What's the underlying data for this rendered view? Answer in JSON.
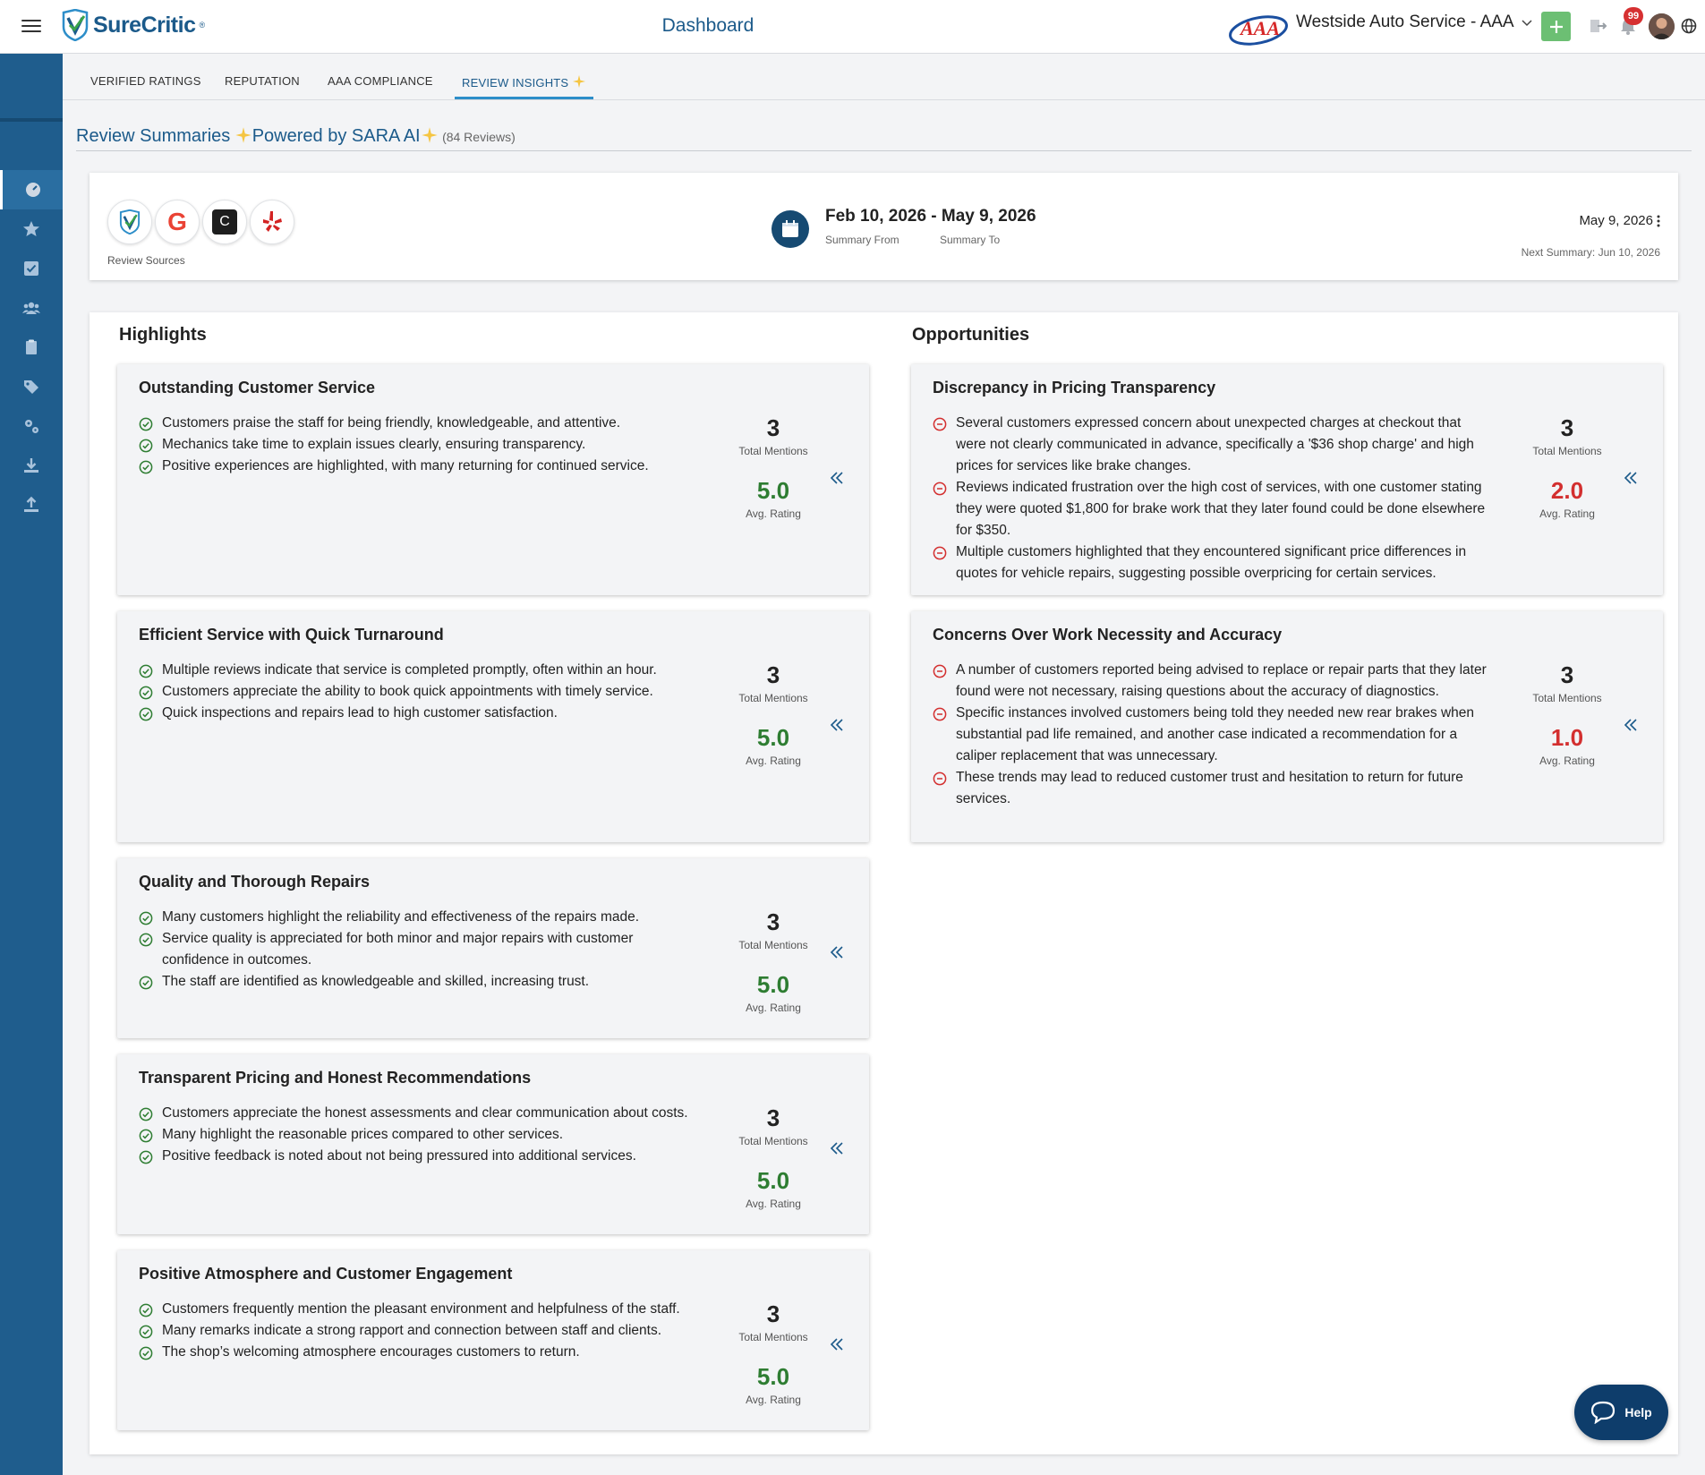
{
  "topbar": {
    "brand": "SureCritic",
    "brand_tm": "®",
    "title": "Dashboard",
    "aaa_logo_text": "AAA",
    "location": "Westside Auto Service - AAA",
    "notification_count": "99"
  },
  "tabs": [
    {
      "label": "VERIFIED RATINGS"
    },
    {
      "label": "REPUTATION"
    },
    {
      "label": "AAA COMPLIANCE"
    },
    {
      "label": "REVIEW INSIGHTS"
    }
  ],
  "section": {
    "title": "Review Summaries",
    "powered": "Powered by SARA AI",
    "count": "(84 Reviews)"
  },
  "sources": {
    "label": "Review Sources",
    "items": [
      "surecritic-source",
      "google-source",
      "carfax-source",
      "yelp-source"
    ],
    "carfax_letter": "C",
    "google_letter": "G"
  },
  "dates": {
    "range": "Feb 10, 2026 - May 9, 2026",
    "from_label": "Summary From",
    "to_label": "Summary To",
    "current": "May 9, 2026",
    "next": "Next Summary: Jun 10, 2026"
  },
  "highlights": {
    "heading": "Highlights",
    "cards": [
      {
        "title": "Outstanding Customer Service",
        "bullets": [
          "Customers praise the staff for being friendly, knowledgeable, and attentive.",
          "Mechanics take time to explain issues clearly, ensuring transparency.",
          "Positive experiences are highlighted, with many returning for continued service."
        ],
        "mentions": "3",
        "mentions_label": "Total Mentions",
        "rating": "5.0",
        "rating_label": "Avg. Rating"
      },
      {
        "title": "Efficient Service with Quick Turnaround",
        "bullets": [
          "Multiple reviews indicate that service is completed promptly, often within an hour.",
          "Customers appreciate the ability to book quick appointments with timely service.",
          "Quick inspections and repairs lead to high customer satisfaction."
        ],
        "mentions": "3",
        "mentions_label": "Total Mentions",
        "rating": "5.0",
        "rating_label": "Avg. Rating"
      },
      {
        "title": "Quality and Thorough Repairs",
        "bullets": [
          "Many customers highlight the reliability and effectiveness of the repairs made.",
          "Service quality is appreciated for both minor and major repairs with customer confidence in outcomes.",
          "The staff are identified as knowledgeable and skilled, increasing trust."
        ],
        "mentions": "3",
        "mentions_label": "Total Mentions",
        "rating": "5.0",
        "rating_label": "Avg. Rating"
      },
      {
        "title": "Transparent Pricing and Honest Recommendations",
        "bullets": [
          "Customers appreciate the honest assessments and clear communication about costs.",
          "Many highlight the reasonable prices compared to other services.",
          "Positive feedback is noted about not being pressured into additional services."
        ],
        "mentions": "3",
        "mentions_label": "Total Mentions",
        "rating": "5.0",
        "rating_label": "Avg. Rating"
      },
      {
        "title": "Positive Atmosphere and Customer Engagement",
        "bullets": [
          "Customers frequently mention the pleasant environment and helpfulness of the staff.",
          "Many remarks indicate a strong rapport and connection between staff and clients.",
          "The shop’s welcoming atmosphere encourages customers to return."
        ],
        "mentions": "3",
        "mentions_label": "Total Mentions",
        "rating": "5.0",
        "rating_label": "Avg. Rating"
      }
    ]
  },
  "opportunities": {
    "heading": "Opportunities",
    "cards": [
      {
        "title": "Discrepancy in Pricing Transparency",
        "bullets": [
          "Several customers expressed concern about unexpected charges at checkout that were not clearly communicated in advance, specifically a '$36 shop charge' and high prices for services like brake changes.",
          "Reviews indicated frustration over the high cost of services, with one customer stating they were quoted $1,800 for brake work that they later found could be done elsewhere for $350.",
          "Multiple customers highlighted that they encountered significant price differences in quotes for vehicle repairs, suggesting possible overpricing for certain services."
        ],
        "mentions": "3",
        "mentions_label": "Total Mentions",
        "rating": "2.0",
        "rating_label": "Avg. Rating"
      },
      {
        "title": "Concerns Over Work Necessity and Accuracy",
        "bullets": [
          "A number of customers reported being advised to replace or repair parts that they later found were not necessary, raising questions about the accuracy of diagnostics.",
          "Specific instances involved customers being told they needed new rear brakes when substantial pad life remained, and another case indicated a recommendation for a caliper replacement that was unnecessary.",
          "These trends may lead to reduced customer trust and hesitation to return for future services."
        ],
        "mentions": "3",
        "mentions_label": "Total Mentions",
        "rating": "1.0",
        "rating_label": "Avg. Rating"
      }
    ]
  },
  "help": {
    "label": "Help"
  },
  "colors": {
    "brand_blue": "#1b5a8a",
    "sidebar": "#1f5d8d",
    "positive_green": "#2e7d32",
    "negative_red": "#d32f2f",
    "add_green": "#6cbf73",
    "help_navy": "#0e3d6b"
  }
}
